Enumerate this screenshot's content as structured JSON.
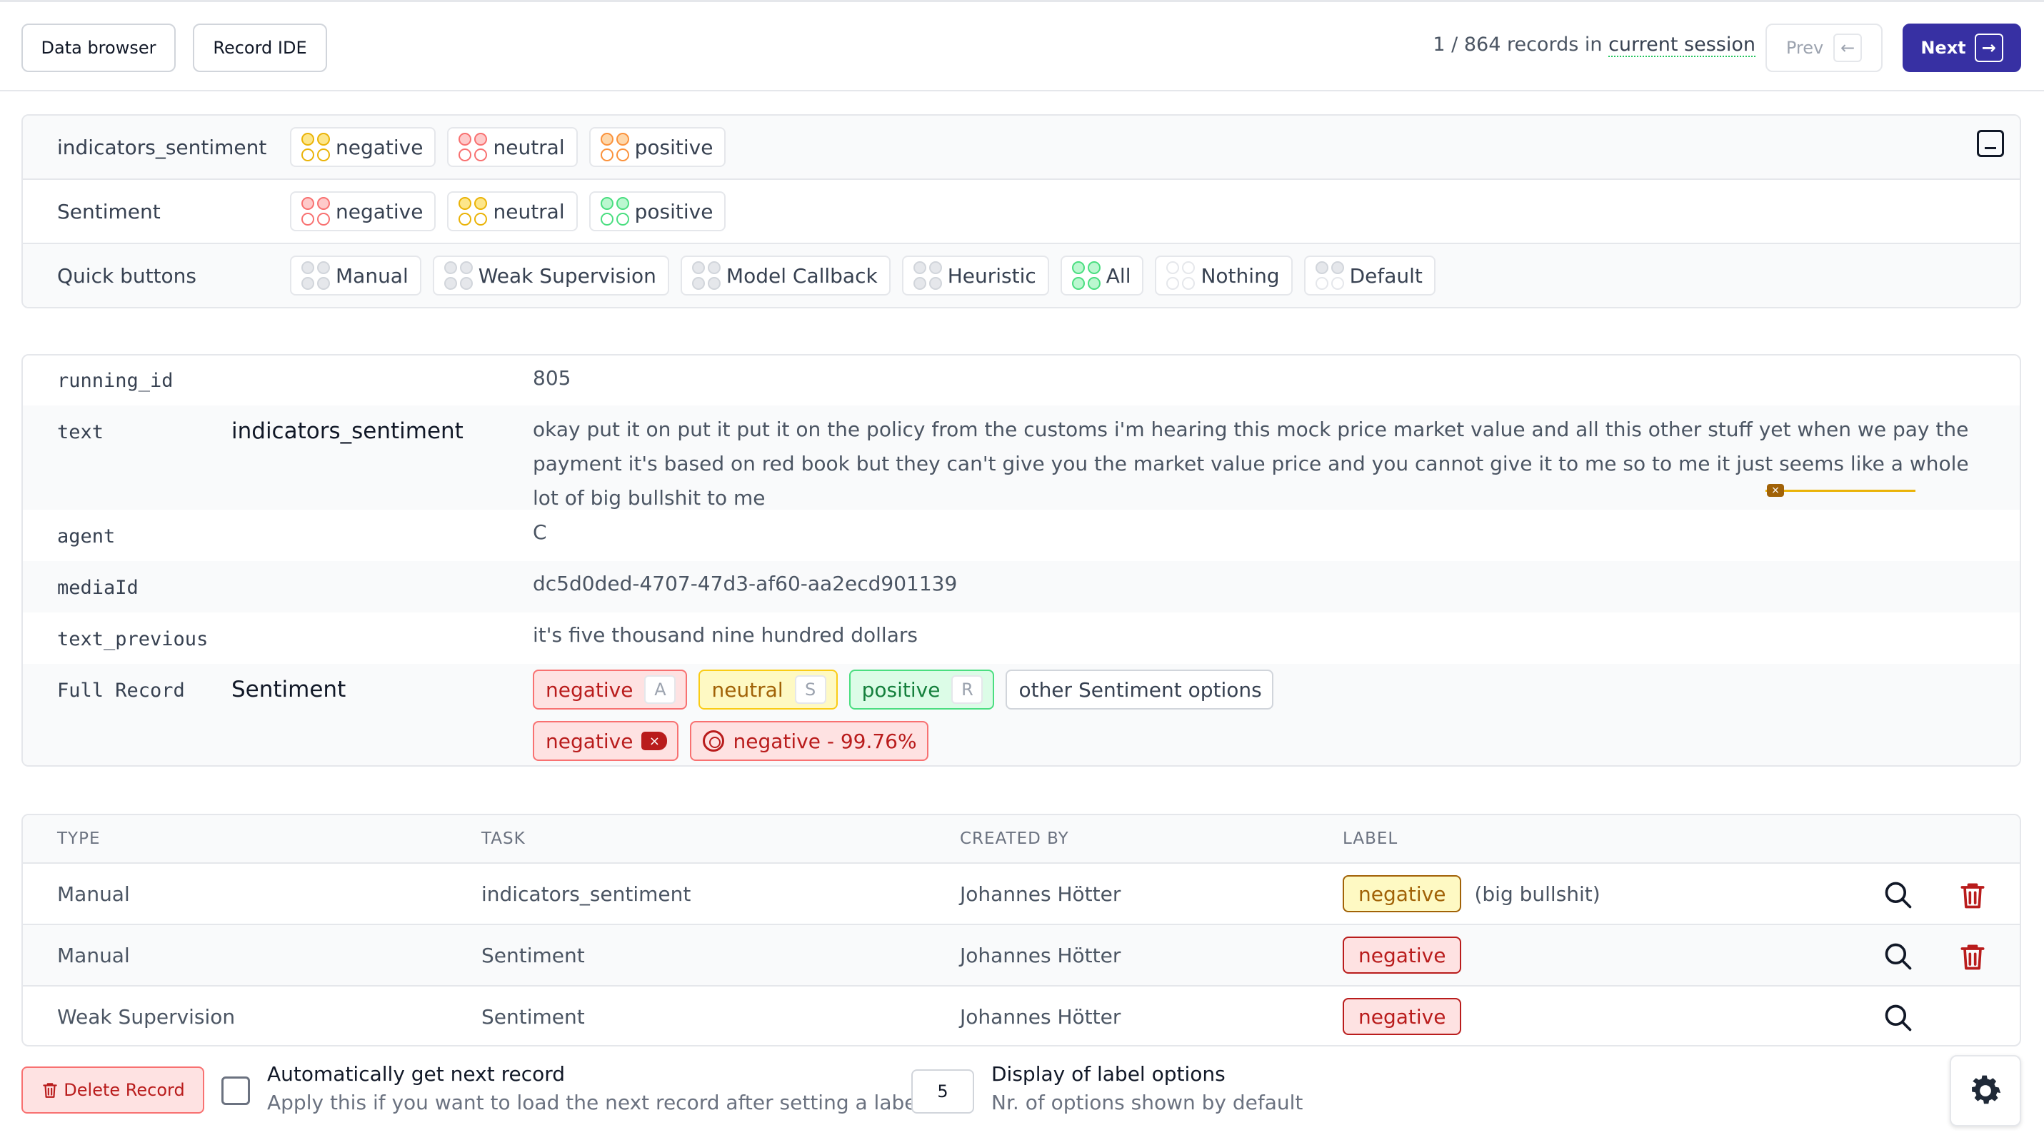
{
  "topbar": {
    "data_browser_label": "Data browser",
    "record_ide_label": "Record IDE",
    "session_prefix": "1 / 864 records in ",
    "session_link": "current session",
    "prev_label": "Prev",
    "next_label": "Next"
  },
  "label_rows": [
    {
      "label": "indicators_sentiment",
      "chips": [
        "negative",
        "neutral",
        "positive"
      ]
    },
    {
      "label": "Sentiment",
      "chips": [
        "negative",
        "neutral",
        "positive"
      ]
    },
    {
      "label": "Quick buttons",
      "chips": [
        "Manual",
        "Weak Supervision",
        "Model Callback",
        "Heuristic",
        "All",
        "Nothing",
        "Default"
      ]
    }
  ],
  "record": {
    "running_id": {
      "name": "running_id",
      "value": "805"
    },
    "text": {
      "name": "text",
      "task": "indicators_sentiment",
      "value": "okay put it on put it put it on the policy from the customs i'm hearing this mock price market value and all this other stuff yet when we pay the payment it's based on red book but they can't give you the market value price and you cannot give it to me so to me it just seems like a whole lot of big bullshit to me"
    },
    "agent": {
      "name": "agent",
      "value": "C"
    },
    "mediaId": {
      "name": "mediaId",
      "value": "dc5d0ded-4707-47d3-af60-aa2ecd901139"
    },
    "text_previous": {
      "name": "text_previous",
      "value": "it's five thousand nine hundred dollars"
    },
    "full_record": {
      "name": "Full Record",
      "task": "Sentiment",
      "options": [
        {
          "label": "negative",
          "key": "A"
        },
        {
          "label": "neutral",
          "key": "S"
        },
        {
          "label": "positive",
          "key": "R"
        }
      ],
      "other_options": "other Sentiment options",
      "set_label": "negative",
      "ws_label": "negative - 99.76%"
    }
  },
  "table": {
    "headers": [
      "TYPE",
      "TASK",
      "CREATED BY",
      "LABEL"
    ],
    "rows": [
      {
        "type": "Manual",
        "task": "indicators_sentiment",
        "created_by": "Johannes Hötter",
        "label": "negative",
        "note": "(big bullshit)"
      },
      {
        "type": "Manual",
        "task": "Sentiment",
        "created_by": "Johannes Hötter",
        "label": "negative",
        "note": ""
      },
      {
        "type": "Weak Supervision",
        "task": "Sentiment",
        "created_by": "Johannes Hötter",
        "label": "negative",
        "note": ""
      }
    ]
  },
  "bottombar": {
    "delete_label": "Delete Record",
    "auto_title": "Automatically get next record",
    "auto_sub": "Apply this if you want to load the next record after setting a label",
    "display_value": "5",
    "display_title": "Display of label options",
    "display_sub": "Nr. of options shown by default"
  },
  "colors": {
    "accent": "#3730a3",
    "negative": "#b91c1c",
    "neutral": "#a16207",
    "positive": "#15803d",
    "highlight": "#eab308"
  }
}
